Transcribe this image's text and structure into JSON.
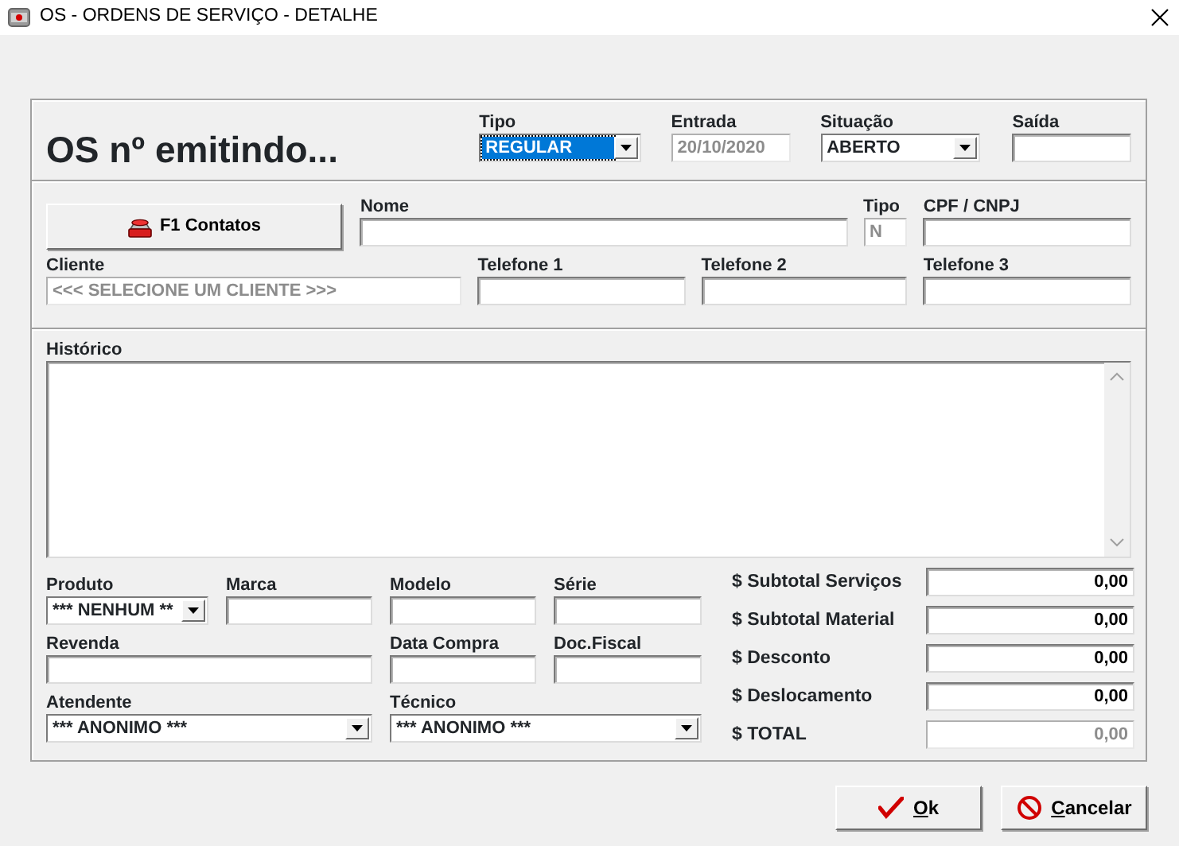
{
  "window": {
    "title": "OS - ORDENS DE SERVIÇO - DETALHE"
  },
  "header": {
    "heading": "OS nº emitindo...",
    "fields": [
      {
        "kind": "select",
        "label": "Tipo",
        "value": "REGULAR",
        "highlighted": true,
        "disabled": false
      },
      {
        "kind": "text",
        "label": "Entrada",
        "value": "20/10/2020",
        "disabled": true
      },
      {
        "kind": "select",
        "label": "Situação",
        "value": "ABERTO",
        "highlighted": false,
        "disabled": false
      },
      {
        "kind": "text",
        "label": "Saída",
        "disabled": false
      }
    ]
  },
  "client": {
    "contacts_button": "F1 Contatos",
    "fields": [
      {
        "kind": "text",
        "label": "Nome",
        "disabled": false
      },
      {
        "kind": "text",
        "label": "Tipo",
        "value": "N",
        "disabled": true
      },
      {
        "kind": "text",
        "label": "CPF / CNPJ",
        "disabled": false
      },
      {
        "kind": "text",
        "label": "Cliente",
        "value": "<<< SELECIONE UM CLIENTE >>>",
        "disabled": true
      },
      {
        "kind": "text",
        "label": "Telefone 1",
        "disabled": false
      },
      {
        "kind": "text",
        "label": "Telefone 2",
        "disabled": false
      },
      {
        "kind": "text",
        "label": "Telefone 3",
        "disabled": false
      }
    ]
  },
  "history": {
    "label": "Histórico"
  },
  "product": {
    "fields": [
      {
        "kind": "select",
        "label": "Produto",
        "value": "*** NENHUM **",
        "highlighted": false,
        "disabled": false
      },
      {
        "kind": "text",
        "label": "Marca",
        "disabled": false
      },
      {
        "kind": "text",
        "label": "Modelo",
        "disabled": false
      },
      {
        "kind": "text",
        "label": "Série",
        "disabled": false
      },
      {
        "kind": "text",
        "label": "Revenda",
        "disabled": false
      },
      {
        "kind": "text",
        "label": "Data Compra",
        "disabled": false
      },
      {
        "kind": "text",
        "label": "Doc.Fiscal",
        "disabled": false
      },
      {
        "kind": "select",
        "label": "Atendente",
        "value": "*** ANONIMO ***",
        "highlighted": false,
        "disabled": false
      },
      {
        "kind": "select",
        "label": "Técnico",
        "value": "*** ANONIMO ***",
        "highlighted": false,
        "disabled": false
      }
    ]
  },
  "totals": [
    {
      "label": "$ Subtotal Serviços",
      "value": "0,00",
      "disabled": false
    },
    {
      "label": "$ Subtotal Material",
      "value": "0,00",
      "disabled": false
    },
    {
      "label": "$ Desconto",
      "value": "0,00",
      "disabled": false
    },
    {
      "label": "$ Deslocamento",
      "value": "0,00",
      "disabled": false
    },
    {
      "label": "$ TOTAL",
      "value": "0,00",
      "disabled": true
    }
  ],
  "buttons": [
    {
      "kind": "ok",
      "label": "Ok"
    },
    {
      "kind": "cancel",
      "label": "Cancelar"
    }
  ]
}
